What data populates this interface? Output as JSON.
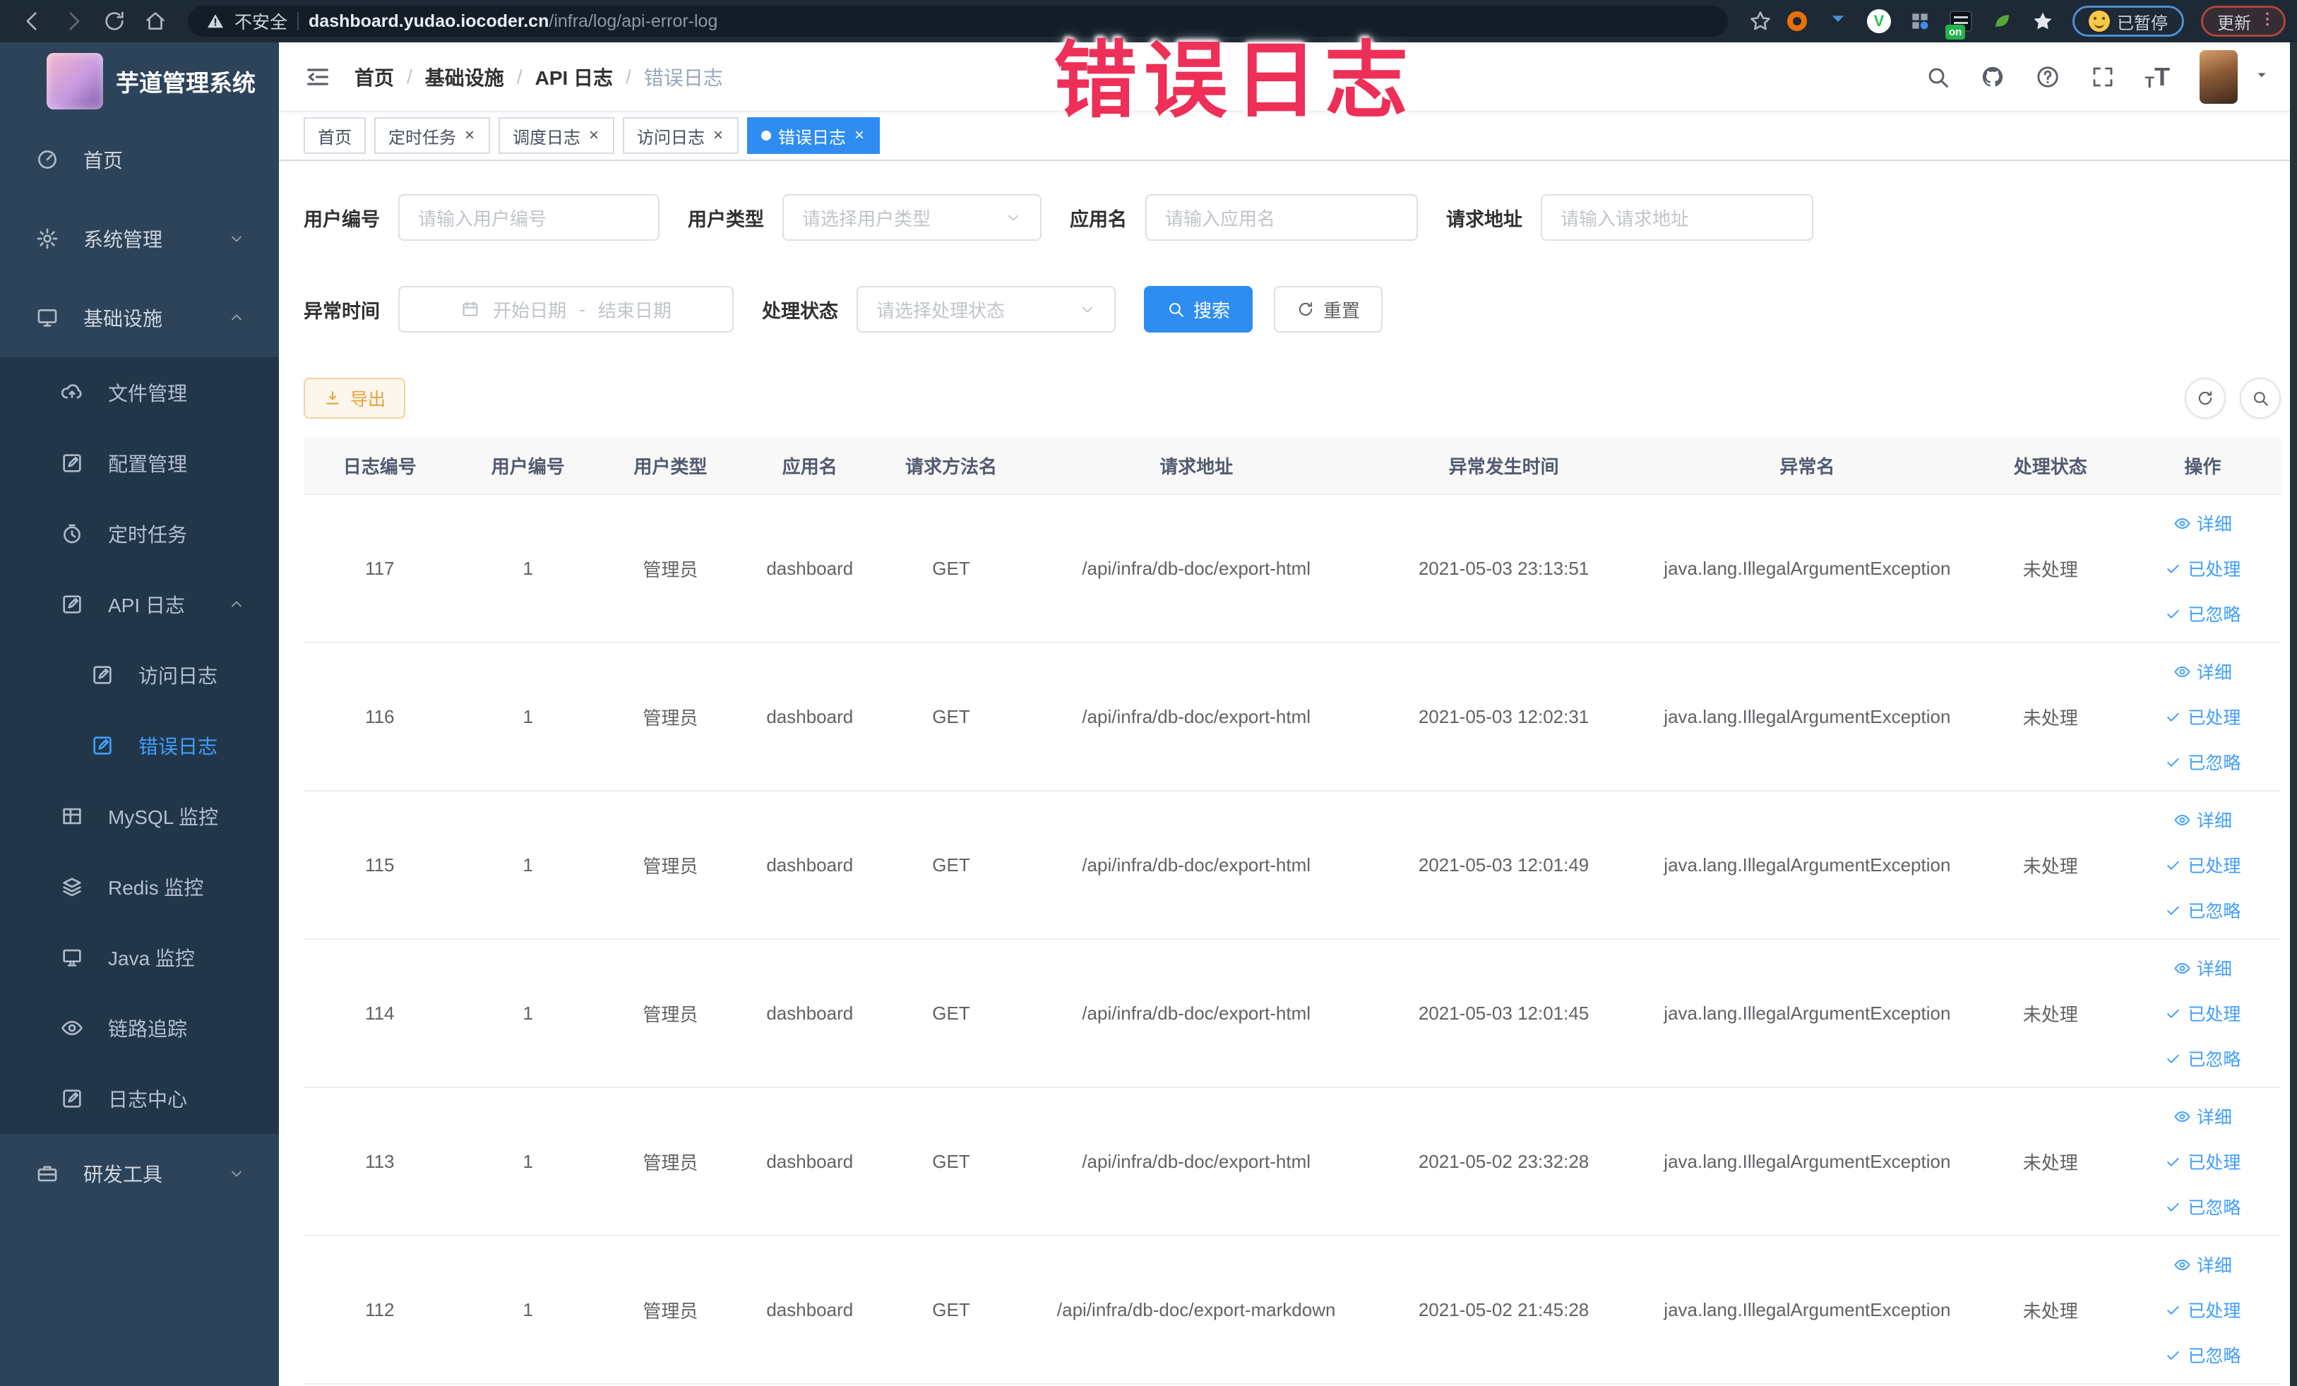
{
  "browser": {
    "security_label": "不安全",
    "url_domain": "dashboard.yudao.iocoder.cn",
    "url_path": "/infra/log/api-error-log",
    "paused_label": "已暂停",
    "update_label": "更新",
    "extensions": [
      {
        "name": "extension-orange-ring-icon",
        "shape": "ring"
      },
      {
        "name": "extension-blue-drop-icon",
        "shape": "drop"
      },
      {
        "name": "extension-green-v-icon",
        "shape": "circle-v",
        "letter": "V"
      },
      {
        "name": "extension-grid-icon",
        "shape": "grid"
      },
      {
        "name": "extension-onetab-icon",
        "shape": "on",
        "badge": "on"
      },
      {
        "name": "extension-leaf-icon",
        "shape": "leaf"
      },
      {
        "name": "extension-star-icon",
        "shape": "star"
      }
    ]
  },
  "annotation": {
    "text": "错误日志",
    "color": "#ee2f57"
  },
  "sidebar": {
    "logo_title": "芋道管理系统",
    "menu": [
      {
        "name": "home",
        "label": "首页",
        "icon": "gauge",
        "level": 0
      },
      {
        "name": "system-management",
        "label": "系统管理",
        "icon": "gear",
        "level": 0,
        "arrow": "down"
      },
      {
        "name": "infrastructure",
        "label": "基础设施",
        "icon": "monitor",
        "level": 0,
        "arrow": "up"
      },
      {
        "name": "file-management",
        "label": "文件管理",
        "icon": "cloud-upload",
        "level": 1,
        "sub": true
      },
      {
        "name": "config-management",
        "label": "配置管理",
        "icon": "edit-square",
        "level": 1,
        "sub": true
      },
      {
        "name": "scheduled-jobs",
        "label": "定时任务",
        "icon": "timer",
        "level": 1,
        "sub": true
      },
      {
        "name": "api-log",
        "label": "API 日志",
        "icon": "edit-square",
        "level": 1,
        "sub": true,
        "arrow": "up"
      },
      {
        "name": "access-log",
        "label": "访问日志",
        "icon": "edit-square",
        "level": 2,
        "sub": true
      },
      {
        "name": "error-log",
        "label": "错误日志",
        "icon": "edit-square",
        "level": 2,
        "sub": true,
        "active": true
      },
      {
        "name": "mysql-monitor",
        "label": "MySQL 监控",
        "icon": "table",
        "level": 1,
        "sub": true
      },
      {
        "name": "redis-monitor",
        "label": "Redis 监控",
        "icon": "layers",
        "level": 1,
        "sub": true
      },
      {
        "name": "java-monitor",
        "label": "Java 监控",
        "icon": "display",
        "level": 1,
        "sub": true
      },
      {
        "name": "trace",
        "label": "链路追踪",
        "icon": "eye",
        "level": 1,
        "sub": true
      },
      {
        "name": "log-center",
        "label": "日志中心",
        "icon": "edit-square",
        "level": 1,
        "sub": true
      },
      {
        "name": "dev-tools",
        "label": "研发工具",
        "icon": "toolbox",
        "level": 0,
        "arrow": "down"
      }
    ]
  },
  "header": {
    "breadcrumb": [
      "首页",
      "基础设施",
      "API 日志",
      "错误日志"
    ]
  },
  "tags_view": [
    {
      "name": "tab-home",
      "label": "首页",
      "closable": false,
      "active": false
    },
    {
      "name": "tab-job",
      "label": "定时任务",
      "closable": true,
      "active": false
    },
    {
      "name": "tab-job-log",
      "label": "调度日志",
      "closable": true,
      "active": false
    },
    {
      "name": "tab-access-log",
      "label": "访问日志",
      "closable": true,
      "active": false
    },
    {
      "name": "tab-error-log",
      "label": "错误日志",
      "closable": true,
      "active": true
    }
  ],
  "filters": {
    "user_id": {
      "label": "用户编号",
      "placeholder": "请输入用户编号"
    },
    "user_type": {
      "label": "用户类型",
      "placeholder": "请选择用户类型"
    },
    "app_name": {
      "label": "应用名",
      "placeholder": "请输入应用名"
    },
    "request_url": {
      "label": "请求地址",
      "placeholder": "请输入请求地址"
    },
    "exception_time": {
      "label": "异常时间",
      "start_placeholder": "开始日期",
      "separator": "-",
      "end_placeholder": "结束日期"
    },
    "process_status": {
      "label": "处理状态",
      "placeholder": "请选择处理状态"
    },
    "search_button": "搜索",
    "reset_button": "重置"
  },
  "toolbar": {
    "export_button": "导出"
  },
  "table": {
    "columns": [
      "日志编号",
      "用户编号",
      "用户类型",
      "应用名",
      "请求方法名",
      "请求地址",
      "异常发生时间",
      "异常名",
      "处理状态",
      "操作"
    ],
    "col_widths": [
      "7.7%",
      "7.3%",
      "7.1%",
      "7%",
      "7.3%",
      "17.5%",
      "13.6%",
      "17.1%",
      "7.5%",
      "7.9%"
    ],
    "actions": [
      "详细",
      "已处理",
      "已忽略"
    ],
    "rows": [
      {
        "id": "117",
        "user_id": "1",
        "user_type": "管理员",
        "app": "dashboard",
        "method": "GET",
        "url": "/api/infra/db-doc/export-html",
        "time": "2021-05-03 23:13:51",
        "exception": "java.lang.IllegalArgumentException",
        "status": "未处理"
      },
      {
        "id": "116",
        "user_id": "1",
        "user_type": "管理员",
        "app": "dashboard",
        "method": "GET",
        "url": "/api/infra/db-doc/export-html",
        "time": "2021-05-03 12:02:31",
        "exception": "java.lang.IllegalArgumentException",
        "status": "未处理"
      },
      {
        "id": "115",
        "user_id": "1",
        "user_type": "管理员",
        "app": "dashboard",
        "method": "GET",
        "url": "/api/infra/db-doc/export-html",
        "time": "2021-05-03 12:01:49",
        "exception": "java.lang.IllegalArgumentException",
        "status": "未处理"
      },
      {
        "id": "114",
        "user_id": "1",
        "user_type": "管理员",
        "app": "dashboard",
        "method": "GET",
        "url": "/api/infra/db-doc/export-html",
        "time": "2021-05-03 12:01:45",
        "exception": "java.lang.IllegalArgumentException",
        "status": "未处理"
      },
      {
        "id": "113",
        "user_id": "1",
        "user_type": "管理员",
        "app": "dashboard",
        "method": "GET",
        "url": "/api/infra/db-doc/export-html",
        "time": "2021-05-02 23:32:28",
        "exception": "java.lang.IllegalArgumentException",
        "status": "未处理"
      },
      {
        "id": "112",
        "user_id": "1",
        "user_type": "管理员",
        "app": "dashboard",
        "method": "GET",
        "url": "/api/infra/db-doc/export-markdown",
        "time": "2021-05-02 21:45:28",
        "exception": "java.lang.IllegalArgumentException",
        "status": "未处理"
      }
    ]
  }
}
